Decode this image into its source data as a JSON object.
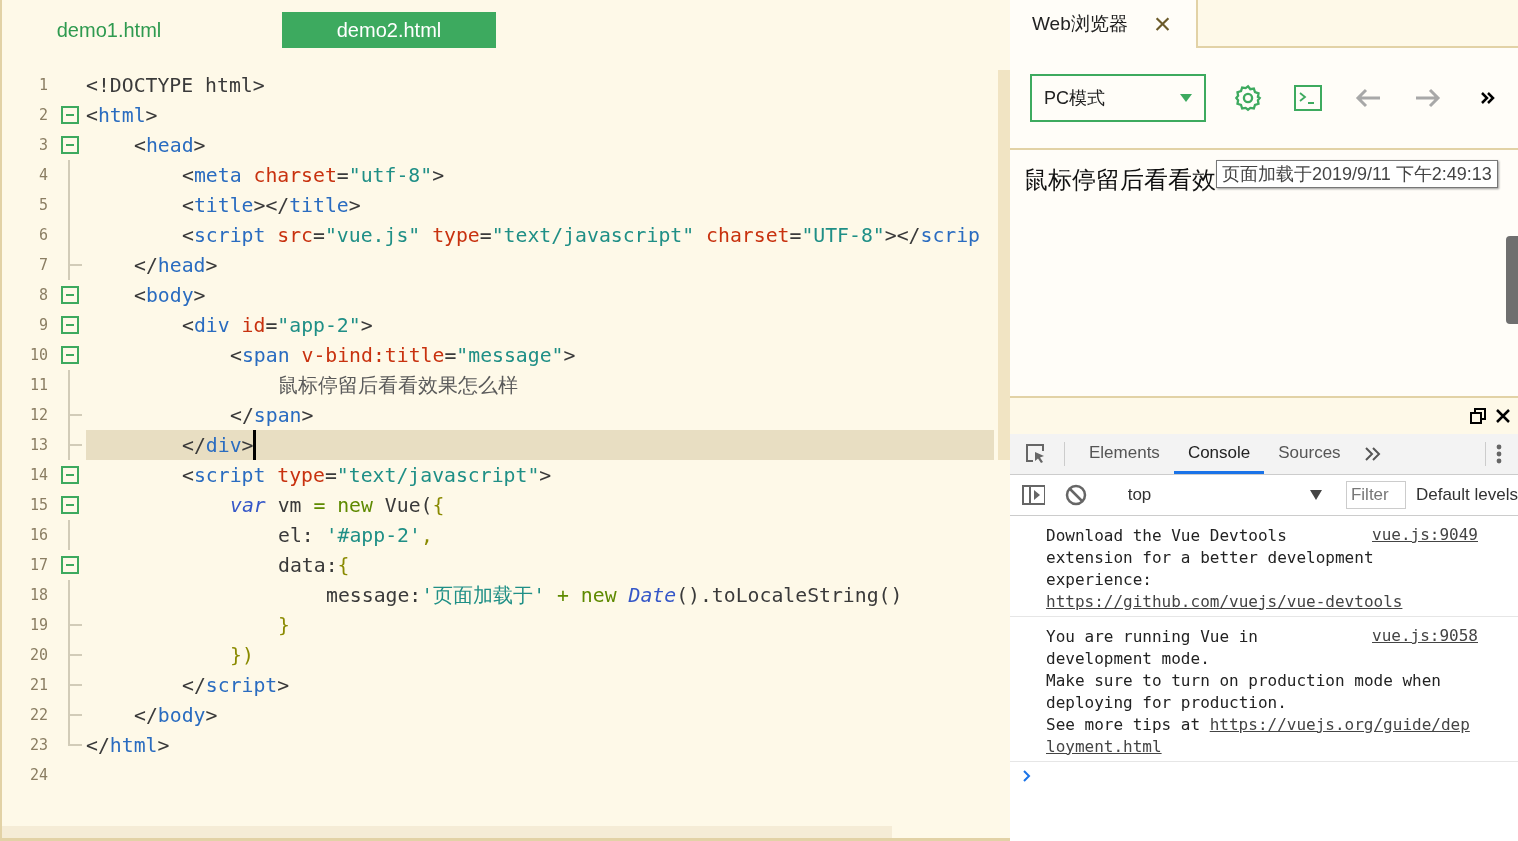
{
  "editor": {
    "tabs": [
      {
        "label": "demo1.html",
        "selected": false
      },
      {
        "label": "demo2.html",
        "selected": true
      }
    ],
    "lines": [
      {
        "number": "1",
        "current": false,
        "tokens": [
          {
            "kind": "punct",
            "text": "<!DOCTYPE html>"
          }
        ]
      },
      {
        "number": "2",
        "current": false,
        "tokens": [
          {
            "kind": "punct",
            "text": "<"
          },
          {
            "kind": "tag",
            "text": "html"
          },
          {
            "kind": "punct",
            "text": ">"
          }
        ],
        "children": [
          {
            "number": "3",
            "current": false,
            "tokens": [
              {
                "kind": "punct",
                "text": "<"
              },
              {
                "kind": "tag",
                "text": "head"
              },
              {
                "kind": "punct",
                "text": ">"
              }
            ],
            "children": [
              {
                "number": "4",
                "current": false,
                "tokens": [
                  {
                    "kind": "punct",
                    "text": "<"
                  },
                  {
                    "kind": "tag",
                    "text": "meta"
                  },
                  {
                    "kind": "attr",
                    "text": " charset"
                  },
                  {
                    "kind": "punct",
                    "text": "="
                  },
                  {
                    "kind": "string",
                    "text": "\"utf-8\""
                  },
                  {
                    "kind": "punct",
                    "text": ">"
                  }
                ]
              },
              {
                "number": "5",
                "current": false,
                "tokens": [
                  {
                    "kind": "punct",
                    "text": "<"
                  },
                  {
                    "kind": "tag",
                    "text": "title"
                  },
                  {
                    "kind": "punct",
                    "text": "></"
                  },
                  {
                    "kind": "tag",
                    "text": "title"
                  },
                  {
                    "kind": "punct",
                    "text": ">"
                  }
                ]
              },
              {
                "number": "6",
                "current": false,
                "tokens": [
                  {
                    "kind": "punct",
                    "text": "<"
                  },
                  {
                    "kind": "tag",
                    "text": "script"
                  },
                  {
                    "kind": "attr",
                    "text": " src"
                  },
                  {
                    "kind": "punct",
                    "text": "="
                  },
                  {
                    "kind": "string",
                    "text": "\"vue.js\""
                  },
                  {
                    "kind": "attr",
                    "text": " type"
                  },
                  {
                    "kind": "punct",
                    "text": "="
                  },
                  {
                    "kind": "string",
                    "text": "\"text/javascript\""
                  },
                  {
                    "kind": "attr",
                    "text": " charset"
                  },
                  {
                    "kind": "punct",
                    "text": "="
                  },
                  {
                    "kind": "string",
                    "text": "\"UTF-8\""
                  },
                  {
                    "kind": "punct",
                    "text": "></"
                  },
                  {
                    "kind": "tag",
                    "text": "scrip"
                  }
                ]
              }
            ]
          },
          {
            "number": "7",
            "current": false,
            "tokens": [
              {
                "kind": "punct",
                "text": "</"
              },
              {
                "kind": "tag",
                "text": "head"
              },
              {
                "kind": "punct",
                "text": ">"
              }
            ]
          },
          {
            "number": "8",
            "current": false,
            "tokens": [
              {
                "kind": "punct",
                "text": "<"
              },
              {
                "kind": "tag",
                "text": "body"
              },
              {
                "kind": "punct",
                "text": ">"
              }
            ],
            "children": [
              {
                "number": "9",
                "current": false,
                "tokens": [
                  {
                    "kind": "punct",
                    "text": "<"
                  },
                  {
                    "kind": "tag",
                    "text": "div"
                  },
                  {
                    "kind": "attr",
                    "text": " id"
                  },
                  {
                    "kind": "punct",
                    "text": "="
                  },
                  {
                    "kind": "string",
                    "text": "\"app-2\""
                  },
                  {
                    "kind": "punct",
                    "text": ">"
                  }
                ],
                "children": [
                  {
                    "number": "10",
                    "current": false,
                    "tokens": [
                      {
                        "kind": "punct",
                        "text": "<"
                      },
                      {
                        "kind": "tag",
                        "text": "span"
                      },
                      {
                        "kind": "attr",
                        "text": " v-bind:title"
                      },
                      {
                        "kind": "punct",
                        "text": "="
                      },
                      {
                        "kind": "string",
                        "text": "\"message\""
                      },
                      {
                        "kind": "punct",
                        "text": ">"
                      }
                    ],
                    "children": [
                      {
                        "number": "11",
                        "current": false,
                        "tokens": [
                          {
                            "kind": "text",
                            "text": "鼠标停留后看看效果怎么样"
                          }
                        ]
                      }
                    ]
                  },
                  {
                    "number": "12",
                    "current": false,
                    "tokens": [
                      {
                        "kind": "punct",
                        "text": "</"
                      },
                      {
                        "kind": "tag",
                        "text": "span"
                      },
                      {
                        "kind": "punct",
                        "text": ">"
                      }
                    ]
                  }
                ]
              },
              {
                "number": "13",
                "current": true,
                "tokens": [
                  {
                    "kind": "punct",
                    "text": "</"
                  },
                  {
                    "kind": "tag",
                    "text": "div"
                  },
                  {
                    "kind": "punct",
                    "text": ">"
                  }
                ]
              },
              {
                "number": "14",
                "current": false,
                "tokens": [
                  {
                    "kind": "punct",
                    "text": "<"
                  },
                  {
                    "kind": "tag",
                    "text": "script"
                  },
                  {
                    "kind": "attr",
                    "text": " type"
                  },
                  {
                    "kind": "punct",
                    "text": "="
                  },
                  {
                    "kind": "string",
                    "text": "\"text/javascript\""
                  },
                  {
                    "kind": "punct",
                    "text": ">"
                  }
                ],
                "children": [
                  {
                    "number": "15",
                    "current": false,
                    "tokens": [
                      {
                        "kind": "keyword",
                        "text": "var"
                      },
                      {
                        "kind": "punct",
                        "text": " vm "
                      },
                      {
                        "kind": "operator",
                        "text": "= new"
                      },
                      {
                        "kind": "punct",
                        "text": " Vue("
                      },
                      {
                        "kind": "brace",
                        "text": "{"
                      }
                    ],
                    "children": [
                      {
                        "number": "16",
                        "current": false,
                        "tokens": [
                          {
                            "kind": "punct",
                            "text": "el: "
                          },
                          {
                            "kind": "string",
                            "text": "'#app-2'"
                          },
                          {
                            "kind": "brace",
                            "text": ","
                          }
                        ]
                      },
                      {
                        "number": "17",
                        "current": false,
                        "tokens": [
                          {
                            "kind": "punct",
                            "text": "data:"
                          },
                          {
                            "kind": "brace",
                            "text": "{"
                          }
                        ],
                        "children": [
                          {
                            "number": "18",
                            "current": false,
                            "tokens": [
                              {
                                "kind": "punct",
                                "text": "message:"
                              },
                              {
                                "kind": "string",
                                "text": "'页面加载于'"
                              },
                              {
                                "kind": "operator",
                                "text": " + new "
                              },
                              {
                                "kind": "keyword",
                                "text": "Date"
                              },
                              {
                                "kind": "punct",
                                "text": "().toLocaleString()"
                              }
                            ]
                          }
                        ]
                      },
                      {
                        "number": "19",
                        "current": false,
                        "tokens": [
                          {
                            "kind": "brace",
                            "text": "}"
                          }
                        ]
                      }
                    ]
                  },
                  {
                    "number": "20",
                    "current": false,
                    "tokens": [
                      {
                        "kind": "brace",
                        "text": "})"
                      }
                    ]
                  }
                ]
              },
              {
                "number": "21",
                "current": false,
                "tokens": [
                  {
                    "kind": "punct",
                    "text": "</"
                  },
                  {
                    "kind": "tag",
                    "text": "script"
                  },
                  {
                    "kind": "punct",
                    "text": ">"
                  }
                ]
              }
            ]
          },
          {
            "number": "22",
            "current": false,
            "tokens": [
              {
                "kind": "punct",
                "text": "</"
              },
              {
                "kind": "tag",
                "text": "body"
              },
              {
                "kind": "punct",
                "text": ">"
              }
            ]
          }
        ]
      },
      {
        "number": "23",
        "current": false,
        "tokens": [
          {
            "kind": "punct",
            "text": "</"
          },
          {
            "kind": "tag",
            "text": "html"
          },
          {
            "kind": "punct",
            "text": ">"
          }
        ]
      },
      {
        "number": "24",
        "current": false
      }
    ]
  },
  "browser": {
    "tab": {
      "label": "Web浏览器",
      "close": "×"
    },
    "mode": "PC模式",
    "toolbar": [
      {
        "kind": "settings",
        "disabled": false
      },
      {
        "kind": "terminal",
        "disabled": false
      },
      {
        "kind": "back",
        "disabled": true
      },
      {
        "kind": "forward",
        "disabled": true
      },
      {
        "kind": "more",
        "disabled": false
      }
    ],
    "page_text": "鼠标停留后看看效",
    "tooltip": "页面加载于2019/9/11 下午2:49:13"
  },
  "devtools": {
    "tabs": [
      {
        "label": "Elements",
        "selected": false
      },
      {
        "label": "Console",
        "selected": true
      },
      {
        "label": "Sources",
        "selected": false
      }
    ],
    "context": "top",
    "filter": {
      "placeholder": "Filter"
    },
    "levels": "Default levels",
    "messages": [
      {
        "source": "vue.js:9049",
        "lines": [
          [
            {
              "kind": "text",
              "text": "Download the Vue Devtools"
            }
          ],
          [
            {
              "kind": "text",
              "text": "extension for a better development"
            }
          ],
          [
            {
              "kind": "text",
              "text": "experience:"
            }
          ],
          [
            {
              "kind": "link",
              "text": "https://github.com/vuejs/vue-devtools"
            }
          ]
        ]
      },
      {
        "source": "vue.js:9058",
        "lines": [
          [
            {
              "kind": "text",
              "text": "You are running Vue in"
            }
          ],
          [
            {
              "kind": "text",
              "text": "development mode."
            }
          ],
          [
            {
              "kind": "text",
              "text": "Make sure to turn on production mode when"
            }
          ],
          [
            {
              "kind": "text",
              "text": "deploying for production."
            }
          ],
          [
            {
              "kind": "text",
              "text": "See more tips at"
            },
            {
              "kind": "link",
              "text": "https://vuejs.org/guide/dep"
            }
          ],
          [
            {
              "kind": "link",
              "text": "loyment.html"
            }
          ]
        ]
      }
    ]
  }
}
